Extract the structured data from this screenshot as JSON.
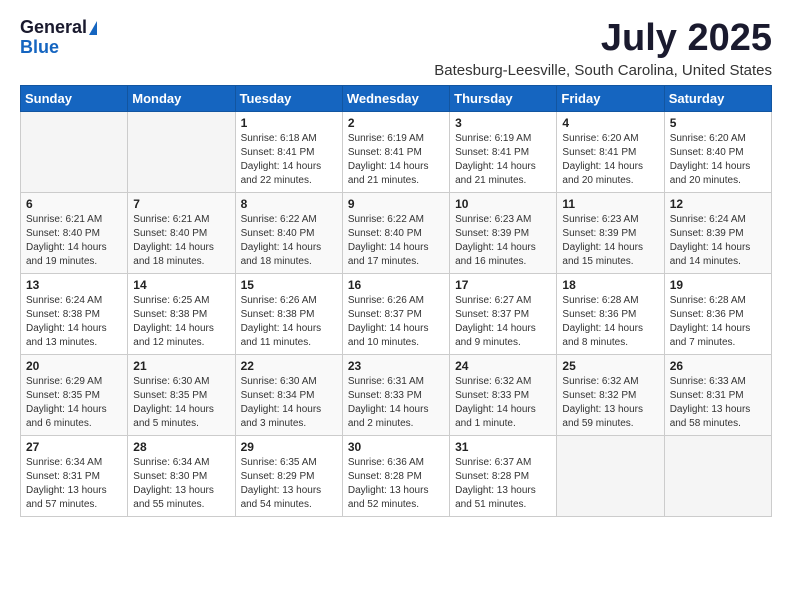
{
  "logo": {
    "general": "General",
    "blue": "Blue"
  },
  "title": {
    "month": "July 2025",
    "location": "Batesburg-Leesville, South Carolina, United States"
  },
  "weekdays": [
    "Sunday",
    "Monday",
    "Tuesday",
    "Wednesday",
    "Thursday",
    "Friday",
    "Saturday"
  ],
  "weeks": [
    [
      {
        "day": "",
        "info": ""
      },
      {
        "day": "",
        "info": ""
      },
      {
        "day": "1",
        "info": "Sunrise: 6:18 AM\nSunset: 8:41 PM\nDaylight: 14 hours and 22 minutes."
      },
      {
        "day": "2",
        "info": "Sunrise: 6:19 AM\nSunset: 8:41 PM\nDaylight: 14 hours and 21 minutes."
      },
      {
        "day": "3",
        "info": "Sunrise: 6:19 AM\nSunset: 8:41 PM\nDaylight: 14 hours and 21 minutes."
      },
      {
        "day": "4",
        "info": "Sunrise: 6:20 AM\nSunset: 8:41 PM\nDaylight: 14 hours and 20 minutes."
      },
      {
        "day": "5",
        "info": "Sunrise: 6:20 AM\nSunset: 8:40 PM\nDaylight: 14 hours and 20 minutes."
      }
    ],
    [
      {
        "day": "6",
        "info": "Sunrise: 6:21 AM\nSunset: 8:40 PM\nDaylight: 14 hours and 19 minutes."
      },
      {
        "day": "7",
        "info": "Sunrise: 6:21 AM\nSunset: 8:40 PM\nDaylight: 14 hours and 18 minutes."
      },
      {
        "day": "8",
        "info": "Sunrise: 6:22 AM\nSunset: 8:40 PM\nDaylight: 14 hours and 18 minutes."
      },
      {
        "day": "9",
        "info": "Sunrise: 6:22 AM\nSunset: 8:40 PM\nDaylight: 14 hours and 17 minutes."
      },
      {
        "day": "10",
        "info": "Sunrise: 6:23 AM\nSunset: 8:39 PM\nDaylight: 14 hours and 16 minutes."
      },
      {
        "day": "11",
        "info": "Sunrise: 6:23 AM\nSunset: 8:39 PM\nDaylight: 14 hours and 15 minutes."
      },
      {
        "day": "12",
        "info": "Sunrise: 6:24 AM\nSunset: 8:39 PM\nDaylight: 14 hours and 14 minutes."
      }
    ],
    [
      {
        "day": "13",
        "info": "Sunrise: 6:24 AM\nSunset: 8:38 PM\nDaylight: 14 hours and 13 minutes."
      },
      {
        "day": "14",
        "info": "Sunrise: 6:25 AM\nSunset: 8:38 PM\nDaylight: 14 hours and 12 minutes."
      },
      {
        "day": "15",
        "info": "Sunrise: 6:26 AM\nSunset: 8:38 PM\nDaylight: 14 hours and 11 minutes."
      },
      {
        "day": "16",
        "info": "Sunrise: 6:26 AM\nSunset: 8:37 PM\nDaylight: 14 hours and 10 minutes."
      },
      {
        "day": "17",
        "info": "Sunrise: 6:27 AM\nSunset: 8:37 PM\nDaylight: 14 hours and 9 minutes."
      },
      {
        "day": "18",
        "info": "Sunrise: 6:28 AM\nSunset: 8:36 PM\nDaylight: 14 hours and 8 minutes."
      },
      {
        "day": "19",
        "info": "Sunrise: 6:28 AM\nSunset: 8:36 PM\nDaylight: 14 hours and 7 minutes."
      }
    ],
    [
      {
        "day": "20",
        "info": "Sunrise: 6:29 AM\nSunset: 8:35 PM\nDaylight: 14 hours and 6 minutes."
      },
      {
        "day": "21",
        "info": "Sunrise: 6:30 AM\nSunset: 8:35 PM\nDaylight: 14 hours and 5 minutes."
      },
      {
        "day": "22",
        "info": "Sunrise: 6:30 AM\nSunset: 8:34 PM\nDaylight: 14 hours and 3 minutes."
      },
      {
        "day": "23",
        "info": "Sunrise: 6:31 AM\nSunset: 8:33 PM\nDaylight: 14 hours and 2 minutes."
      },
      {
        "day": "24",
        "info": "Sunrise: 6:32 AM\nSunset: 8:33 PM\nDaylight: 14 hours and 1 minute."
      },
      {
        "day": "25",
        "info": "Sunrise: 6:32 AM\nSunset: 8:32 PM\nDaylight: 13 hours and 59 minutes."
      },
      {
        "day": "26",
        "info": "Sunrise: 6:33 AM\nSunset: 8:31 PM\nDaylight: 13 hours and 58 minutes."
      }
    ],
    [
      {
        "day": "27",
        "info": "Sunrise: 6:34 AM\nSunset: 8:31 PM\nDaylight: 13 hours and 57 minutes."
      },
      {
        "day": "28",
        "info": "Sunrise: 6:34 AM\nSunset: 8:30 PM\nDaylight: 13 hours and 55 minutes."
      },
      {
        "day": "29",
        "info": "Sunrise: 6:35 AM\nSunset: 8:29 PM\nDaylight: 13 hours and 54 minutes."
      },
      {
        "day": "30",
        "info": "Sunrise: 6:36 AM\nSunset: 8:28 PM\nDaylight: 13 hours and 52 minutes."
      },
      {
        "day": "31",
        "info": "Sunrise: 6:37 AM\nSunset: 8:28 PM\nDaylight: 13 hours and 51 minutes."
      },
      {
        "day": "",
        "info": ""
      },
      {
        "day": "",
        "info": ""
      }
    ]
  ]
}
